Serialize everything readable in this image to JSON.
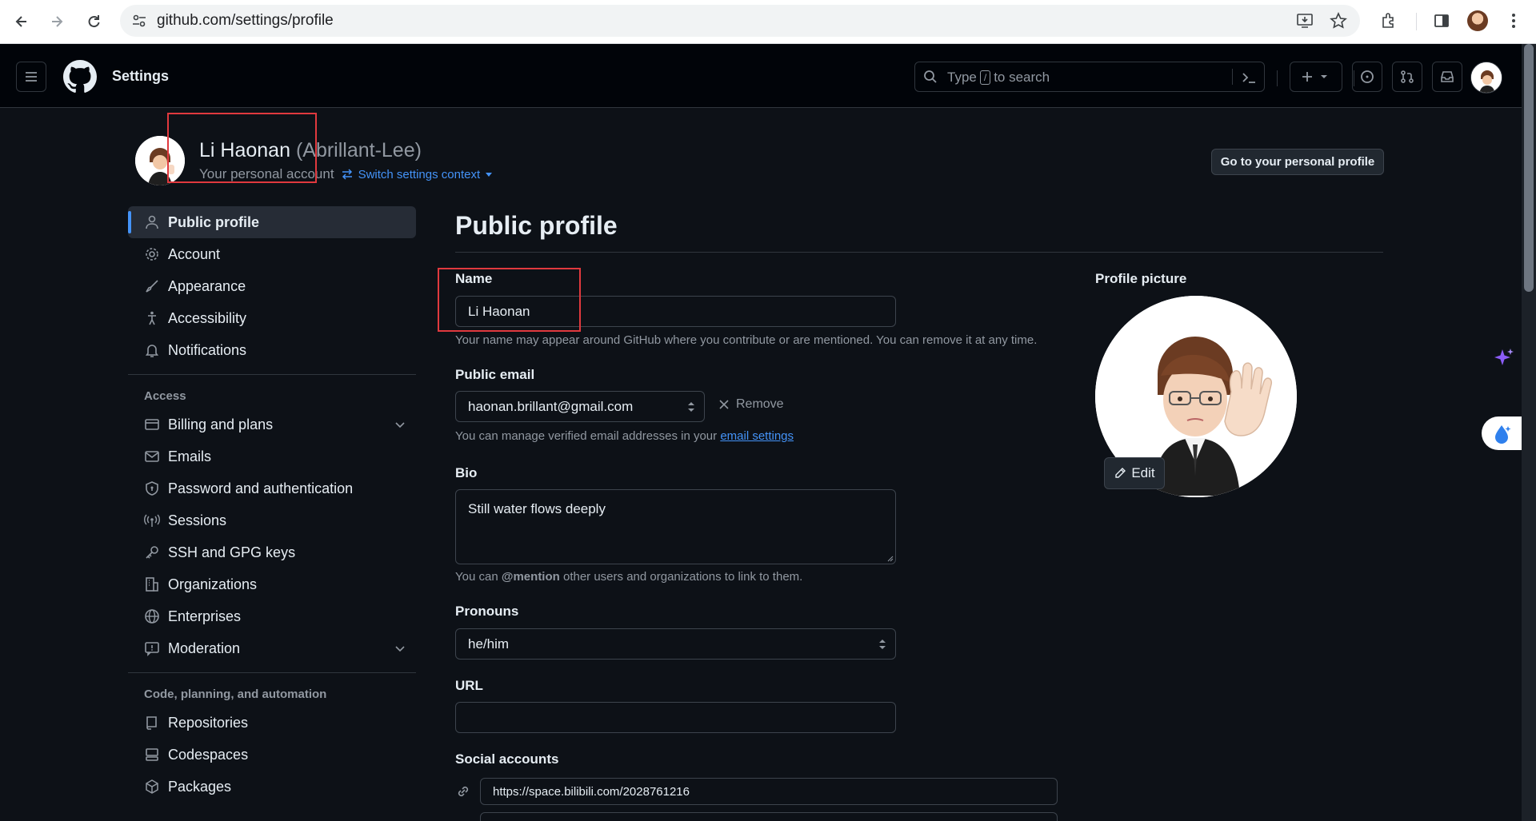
{
  "browser": {
    "url": "github.com/settings/profile"
  },
  "header": {
    "title": "Settings",
    "search_placeholder_before": "Type",
    "search_key": "/",
    "search_placeholder_after": "to search"
  },
  "context": {
    "name": "Li Haonan",
    "login": "(Abrillant-Lee)",
    "subtitle": "Your personal account",
    "switch_label": "Switch settings context",
    "go_profile_button": "Go to your personal profile"
  },
  "sidebar": {
    "items": [
      {
        "label": "Public profile",
        "icon": "person-icon",
        "active": true
      },
      {
        "label": "Account",
        "icon": "gear-icon"
      },
      {
        "label": "Appearance",
        "icon": "paintbrush-icon"
      },
      {
        "label": "Accessibility",
        "icon": "accessibility-icon"
      },
      {
        "label": "Notifications",
        "icon": "bell-icon"
      }
    ],
    "access_heading": "Access",
    "access_items": [
      {
        "label": "Billing and plans",
        "icon": "credit-card-icon",
        "expandable": true
      },
      {
        "label": "Emails",
        "icon": "mail-icon"
      },
      {
        "label": "Password and authentication",
        "icon": "shield-lock-icon"
      },
      {
        "label": "Sessions",
        "icon": "broadcast-icon"
      },
      {
        "label": "SSH and GPG keys",
        "icon": "key-icon"
      },
      {
        "label": "Organizations",
        "icon": "organization-icon"
      },
      {
        "label": "Enterprises",
        "icon": "globe-icon"
      },
      {
        "label": "Moderation",
        "icon": "report-icon",
        "expandable": true
      }
    ],
    "code_heading": "Code, planning, and automation",
    "code_items": [
      {
        "label": "Repositories",
        "icon": "repo-icon"
      },
      {
        "label": "Codespaces",
        "icon": "codespaces-icon"
      },
      {
        "label": "Packages",
        "icon": "package-icon"
      }
    ]
  },
  "main": {
    "title": "Public profile",
    "name_label": "Name",
    "name_value": "Li Haonan",
    "name_hint": "Your name may appear around GitHub where you contribute or are mentioned. You can remove it at any time.",
    "email_label": "Public email",
    "email_value": "haonan.brillant@gmail.com",
    "remove_label": "Remove",
    "email_hint_prefix": "You can manage verified email addresses in your",
    "email_hint_link": "email settings",
    "bio_label": "Bio",
    "bio_value": "Still water flows deeply",
    "bio_hint_prefix": "You can",
    "bio_hint_mention": "@mention",
    "bio_hint_suffix": "other users and organizations to link to them.",
    "pronouns_label": "Pronouns",
    "pronouns_value": "he/him",
    "url_label": "URL",
    "url_value": "",
    "social_label": "Social accounts",
    "social_1": "https://space.bilibili.com/2028761216"
  },
  "profile_picture": {
    "label": "Profile picture",
    "edit_label": "Edit"
  },
  "colors": {
    "accent": "#4493f8",
    "annotation": "#e0393e",
    "background": "#0d1117"
  }
}
